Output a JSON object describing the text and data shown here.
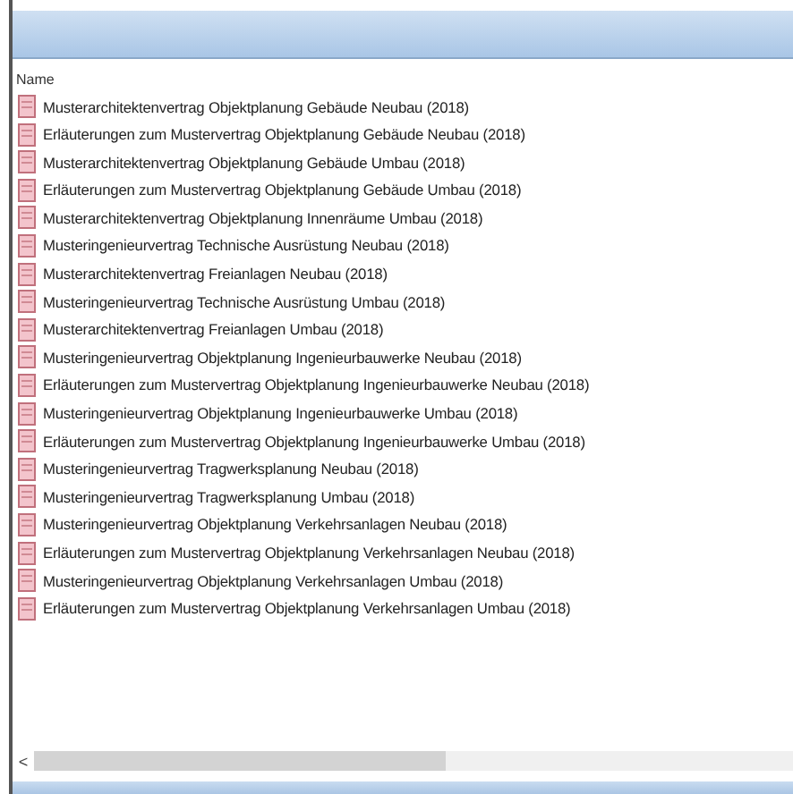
{
  "list": {
    "column": "Name",
    "items": [
      "Musterarchitektenvertrag Objektplanung Gebäude Neubau (2018)",
      "Erläuterungen zum Mustervertrag Objektplanung Gebäude Neubau (2018)",
      "Musterarchitektenvertrag Objektplanung Gebäude Umbau (2018)",
      "Erläuterungen zum Mustervertrag Objektplanung Gebäude Umbau (2018)",
      "Musterarchitektenvertrag Objektplanung Innenräume Umbau (2018)",
      "Musteringenieurvertrag Technische Ausrüstung Neubau (2018)",
      "Musterarchitektenvertrag Freianlagen Neubau (2018)",
      "Musteringenieurvertrag Technische Ausrüstung Umbau (2018)",
      "Musterarchitektenvertrag Freianlagen Umbau (2018)",
      "Musteringenieurvertrag Objektplanung Ingenieurbauwerke Neubau (2018)",
      "Erläuterungen zum Mustervertrag Objektplanung Ingenieurbauwerke Neubau (2018)",
      "Musteringenieurvertrag Objektplanung Ingenieurbauwerke Umbau (2018)",
      "Erläuterungen zum Mustervertrag Objektplanung Ingenieurbauwerke Umbau (2018)",
      "Musteringenieurvertrag Tragwerksplanung Neubau (2018)",
      "Musteringenieurvertrag Tragwerksplanung Umbau (2018)",
      "Musteringenieurvertrag Objektplanung Verkehrsanlagen Neubau (2018)",
      "Erläuterungen zum Mustervertrag Objektplanung Verkehrsanlagen Neubau (2018)",
      "Musteringenieurvertrag Objektplanung Verkehrsanlagen Umbau (2018)",
      "Erläuterungen zum Mustervertrag Objektplanung Verkehrsanlagen Umbau (2018)"
    ],
    "scroll_arrow": "<"
  }
}
